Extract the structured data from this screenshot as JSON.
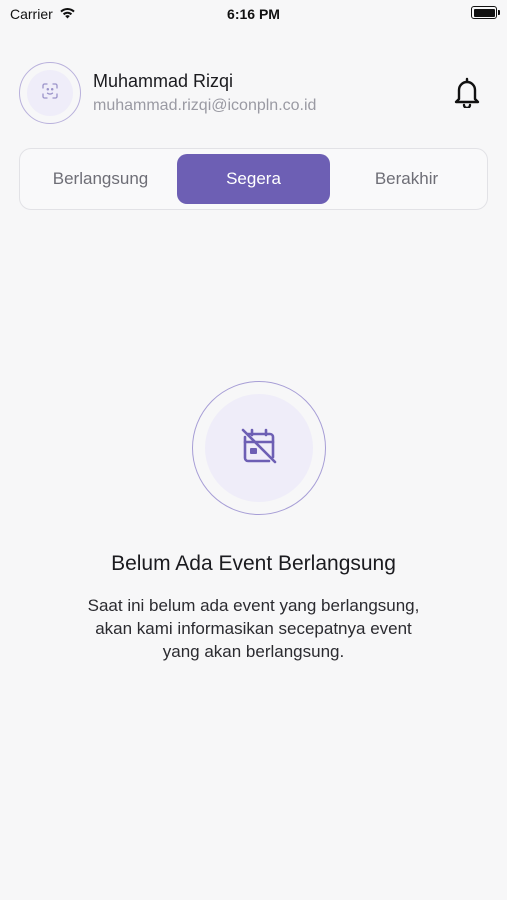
{
  "status_bar": {
    "carrier": "Carrier",
    "time": "6:16 PM",
    "wifi_icon": "wifi-icon",
    "battery_icon": "battery-icon"
  },
  "profile": {
    "name": "Muhammad Rizqi",
    "email": "muhammad.rizqi@iconpln.co.id",
    "avatar_icon": "face-scan-icon",
    "notification_icon": "bell-icon"
  },
  "tabs": [
    {
      "label": "Berlangsung",
      "active": false
    },
    {
      "label": "Segera",
      "active": true
    },
    {
      "label": "Berakhir",
      "active": false
    }
  ],
  "empty_state": {
    "icon": "calendar-off-icon",
    "title": "Belum Ada Event Berlangsung",
    "description_lines": [
      "Saat ini belum ada event yang berlangsung,",
      "akan kami informasikan secepatnya event",
      "yang akan berlangsung."
    ]
  },
  "colors": {
    "accent": "#6d5fb4",
    "accent_light": "#efedf9",
    "background": "#f7f7f8"
  }
}
